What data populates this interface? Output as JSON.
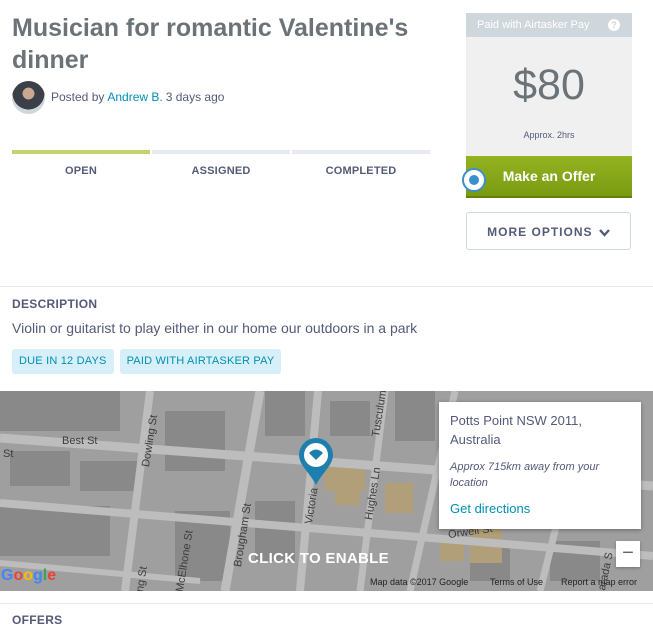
{
  "task": {
    "title": "Musician for romantic Valentine's dinner",
    "posted_by_prefix": "Posted by",
    "poster_name": "Andrew B.",
    "posted_ago": "3 days ago",
    "description_heading": "DESCRIPTION",
    "description": "Violin or guitarist to play either in our home our outdoors in a park",
    "tags": [
      "DUE IN 12 DAYS",
      "PAID WITH AIRTASKER PAY"
    ],
    "offers_heading": "OFFERS"
  },
  "progress": {
    "steps": [
      "OPEN",
      "ASSIGNED",
      "COMPLETED"
    ],
    "active_step": "OPEN"
  },
  "payment": {
    "header": "Paid with Airtasker Pay",
    "help_icon": "question-icon",
    "price": "$80",
    "duration": "Approx. 2hrs",
    "offer_button": "Make an Offer",
    "more_options": "MORE OPTIONS",
    "more_options_icon": "chevron-down-icon"
  },
  "map": {
    "streets": [
      "St",
      "Best St",
      "Dowling St",
      "Brougham St",
      "Victoria",
      "Hughes Ln",
      "Tusculum",
      "McElhone St",
      "ng St",
      "Orwell St",
      "arada S"
    ],
    "overlay_text": "CLICK TO ENABLE",
    "info_location": "Potts Point NSW 2011, Australia",
    "info_distance": "Approx 715km away from your location",
    "info_directions": "Get directions",
    "zoom_out": "−",
    "google_logo": "Google",
    "footer_data": "Map data ©2017 Google",
    "footer_terms": "Terms of Use",
    "footer_report": "Report a map error"
  },
  "colors": {
    "accent_green": "#7a9b12",
    "link_blue": "#008fb4",
    "tag_bg": "#d7eff9",
    "progress_active": "#c1d46e"
  }
}
